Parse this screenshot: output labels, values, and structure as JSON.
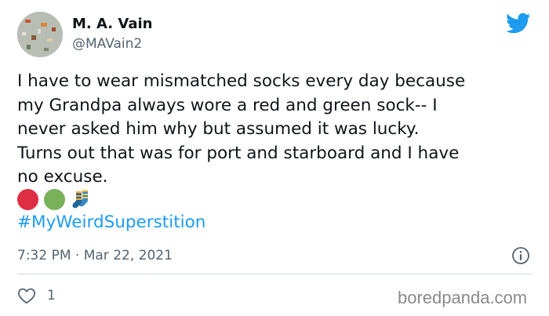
{
  "author": {
    "display_name": "M. A. Vain",
    "handle": "@MAVain2",
    "avatar_icon": "avatar-image"
  },
  "brand_icon": "twitter-bird-icon",
  "brand_color": "#1d9bf0",
  "tweet": {
    "lines": [
      "I have to wear mismatched socks every day because",
      "my Grandpa always wore a red and green sock-- I",
      "never asked him why but assumed it was lucky.",
      "Turns out that was for port and starboard and I have",
      "no excuse."
    ],
    "emojis": [
      "red-circle-icon",
      "green-circle-icon",
      "socks-icon"
    ],
    "hashtag": "#MyWeirdSuperstition"
  },
  "meta": {
    "timestamp": "7:32 PM · Mar 22, 2021",
    "info_icon": "info-icon"
  },
  "actions": {
    "like_icon": "heart-icon",
    "like_count": "1"
  },
  "watermark": "boredpanda.com"
}
